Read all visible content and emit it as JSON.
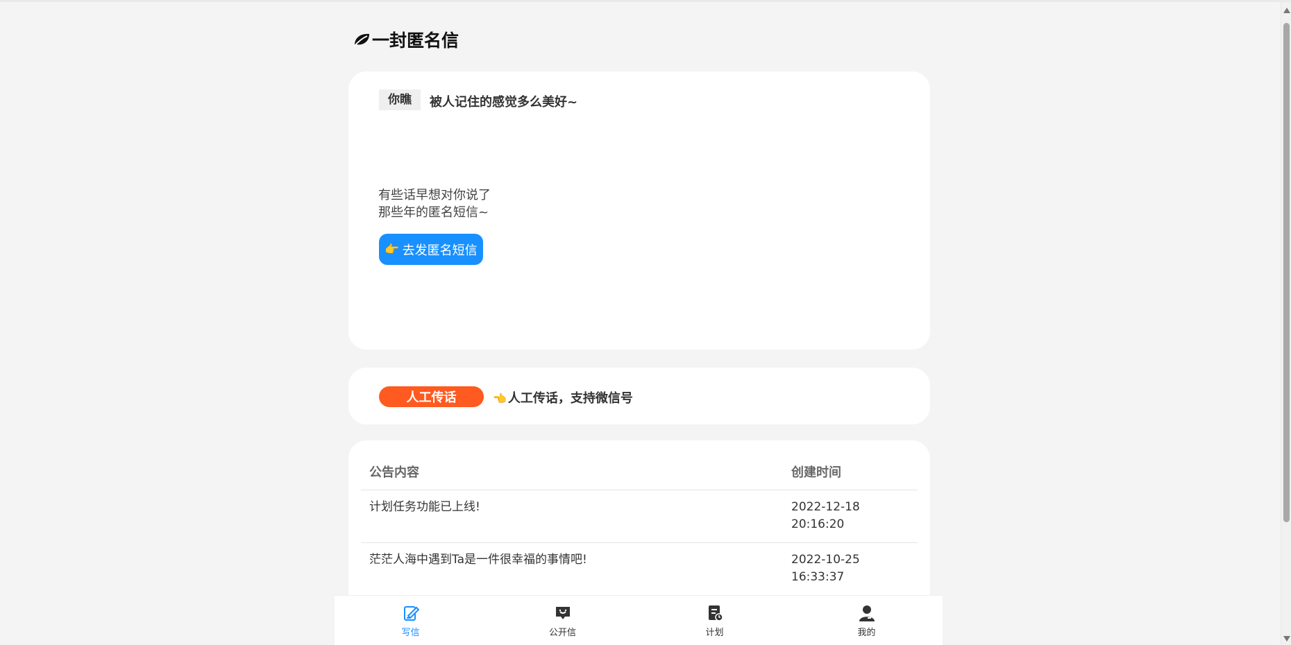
{
  "header": {
    "title": "一封匿名信",
    "logo_icon": "leaf-icon"
  },
  "hero": {
    "tag": "你瞧",
    "slogan": "被人记住的感觉多么美好~",
    "desc_line1": "有些话早想对你说了",
    "desc_line2": "那些年的匿名短信~",
    "button_icon": "👉",
    "button_label": "去发匿名短信",
    "button_color": "#1890ff"
  },
  "human_relay": {
    "tag": "人工传话",
    "tag_color": "#ff5a1f",
    "hand_icon": "👈",
    "desc": "人工传话，支持微信号"
  },
  "announcements": {
    "columns": [
      "公告内容",
      "创建时间"
    ],
    "rows": [
      {
        "content": "计划任务功能已上线!",
        "time": "2022-12-18\n20:16:20"
      },
      {
        "content": "茫茫人海中遇到Ta是一件很幸福的事情吧!",
        "time": "2022-10-25\n16:33:37"
      }
    ]
  },
  "tabbar": {
    "items": [
      {
        "label": "写信",
        "icon": "write-letter-icon",
        "active": true
      },
      {
        "label": "公开信",
        "icon": "public-letter-icon",
        "active": false
      },
      {
        "label": "计划",
        "icon": "plan-icon",
        "active": false
      },
      {
        "label": "我的",
        "icon": "user-icon",
        "active": false
      }
    ],
    "active_color": "#1890ff"
  }
}
